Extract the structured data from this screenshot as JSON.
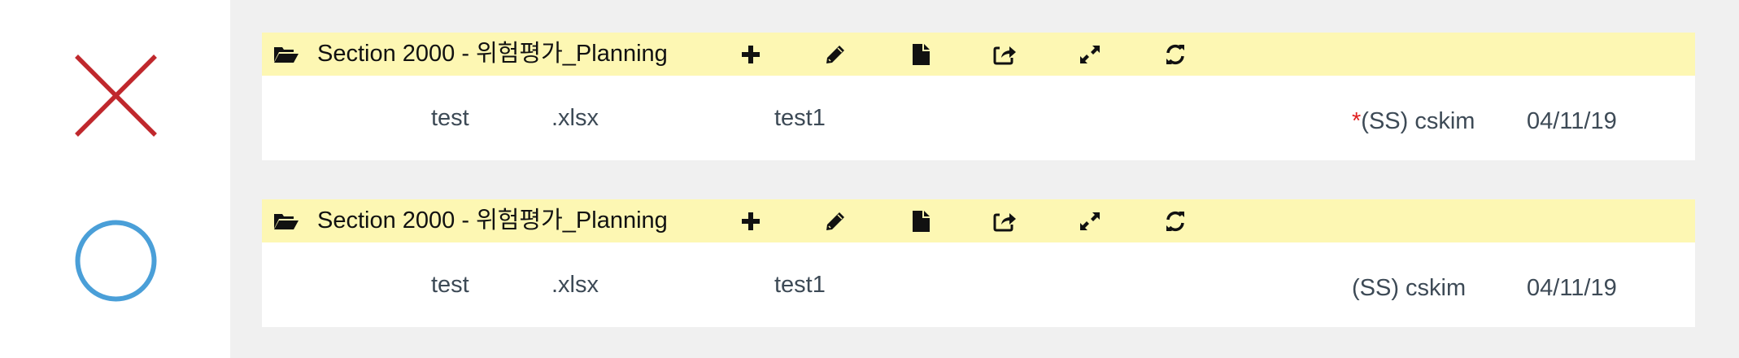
{
  "panels": [
    {
      "title": "Section 2000 - 위험평가_Planning",
      "row": {
        "name": "test",
        "ext": ".xlsx",
        "desc": "test1",
        "required_mark": "*",
        "owner": "(SS) cskim",
        "date": "04/11/19"
      }
    },
    {
      "title": "Section 2000 - 위험평가_Planning",
      "row": {
        "name": "test",
        "ext": ".xlsx",
        "desc": "test1",
        "owner": "(SS) cskim",
        "date": "04/11/19"
      }
    }
  ],
  "icons": {
    "wrong_marker": "x-mark-icon",
    "right_marker": "circle-mark-icon",
    "folder": "folder-open-icon",
    "add": "plus-icon",
    "edit": "pencil-icon",
    "file": "file-icon",
    "share": "share-icon",
    "expand": "expand-icon",
    "refresh": "refresh-icon"
  },
  "colors": {
    "wrong_marker": "#c0282d",
    "right_marker": "#4a9fd8",
    "header_bg": "#fdf7b3",
    "required_mark": "#e02020"
  }
}
